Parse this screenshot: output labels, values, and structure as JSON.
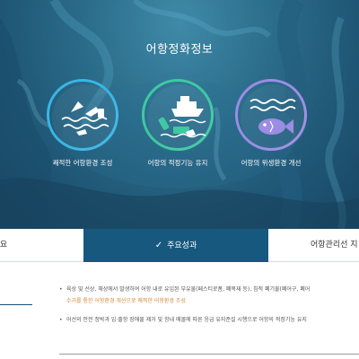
{
  "hero": {
    "title": "어항정화정보",
    "features": [
      {
        "label": "쾌적한 어항환경 조성",
        "icon": "floating-trash-icon",
        "color": "#39b6e4"
      },
      {
        "label": "어항의 적정기능 유지",
        "icon": "cleanup-boat-icon",
        "color": "#3ec9a2"
      },
      {
        "label": "어항의 위생환경 개선",
        "icon": "fish-water-icon",
        "color": "#9a8de3"
      }
    ]
  },
  "tabs": {
    "left_label": "요",
    "active_label": "주요성과",
    "active_check": "✓",
    "right_label": "어항관리선 지",
    "active_color": "#17597e"
  },
  "content": {
    "bullets": [
      {
        "line1": "육상 및 선상, 해상에서 발생하여 어항 내로 유입된 부유물(페스티로폼, 폐목재 등), 침적 폐기물(폐어구, 폐어",
        "line2": "수거를 통한 어항환경 개선으로 쾌적한 어항환경 조성"
      },
      {
        "line1": "어선의 안전 정박과 입·출항 장애물 제거 및 항내 매몰에 따른 응급 유지준설 시행으로 어항의 적정기능 유지"
      }
    ]
  }
}
